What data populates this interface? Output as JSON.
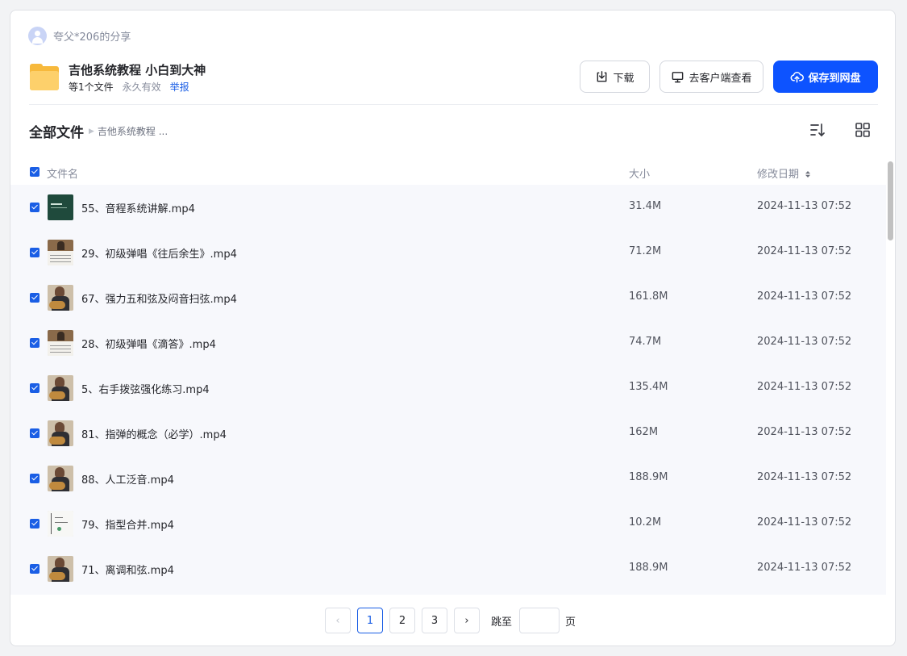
{
  "share": {
    "sharer": "夸父*206的分享",
    "title": "吉他系统教程 小白到大神",
    "file_count": "等1个文件",
    "validity": "永久有效",
    "report": "举报"
  },
  "actions": {
    "download": "下载",
    "open_client": "去客户端查看",
    "save": "保存到网盘"
  },
  "breadcrumb": {
    "root": "全部文件",
    "current": "吉他系统教程 ..."
  },
  "table": {
    "headers": {
      "name": "文件名",
      "size": "大小",
      "date": "修改日期"
    },
    "rows": [
      {
        "name": "55、音程系统讲解.mp4",
        "size": "31.4M",
        "date": "2024-11-13 07:52",
        "thumb": "slide"
      },
      {
        "name": "29、初级弹唱《往后余生》.mp4",
        "size": "71.2M",
        "date": "2024-11-13 07:52",
        "thumb": "tab"
      },
      {
        "name": "67、强力五和弦及闷音扫弦.mp4",
        "size": "161.8M",
        "date": "2024-11-13 07:52",
        "thumb": "player"
      },
      {
        "name": "28、初级弹唱《滴答》.mp4",
        "size": "74.7M",
        "date": "2024-11-13 07:52",
        "thumb": "tab"
      },
      {
        "name": "5、右手拨弦强化练习.mp4",
        "size": "135.4M",
        "date": "2024-11-13 07:52",
        "thumb": "player"
      },
      {
        "name": "81、指弹的概念（必学）.mp4",
        "size": "162M",
        "date": "2024-11-13 07:52",
        "thumb": "player"
      },
      {
        "name": "88、人工泛音.mp4",
        "size": "188.9M",
        "date": "2024-11-13 07:52",
        "thumb": "player"
      },
      {
        "name": "79、指型合并.mp4",
        "size": "10.2M",
        "date": "2024-11-13 07:52",
        "thumb": "chart"
      },
      {
        "name": "71、离调和弦.mp4",
        "size": "188.9M",
        "date": "2024-11-13 07:52",
        "thumb": "player"
      }
    ]
  },
  "pagination": {
    "prev": "‹",
    "pages": [
      "1",
      "2",
      "3"
    ],
    "current": "1",
    "next": "›",
    "jump_label": "跳至",
    "page_label": "页",
    "jump_value": ""
  },
  "colors": {
    "primary": "#0d53ff",
    "link": "#1a5ee5",
    "folder": "#f7b93c"
  }
}
